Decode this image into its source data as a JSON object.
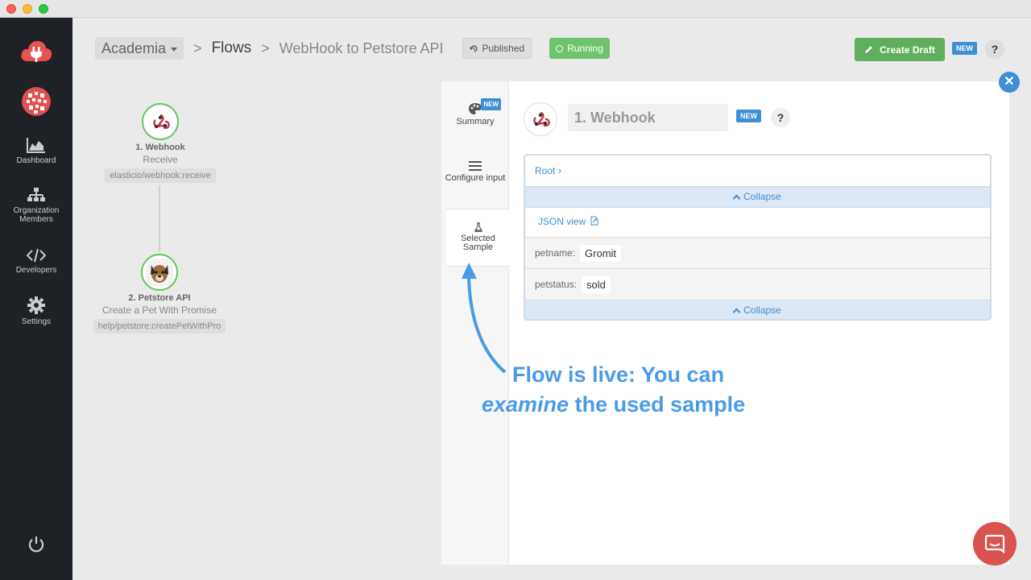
{
  "window": {
    "controls": [
      "close",
      "minimize",
      "zoom"
    ]
  },
  "sidebar": {
    "items": [
      {
        "label": "Dashboard",
        "icon": "dashboard-icon"
      },
      {
        "label": "Organization Members",
        "icon": "org-members-icon"
      },
      {
        "label": "Developers",
        "icon": "code-icon"
      },
      {
        "label": "Settings",
        "icon": "gear-icon"
      }
    ]
  },
  "header": {
    "workspace": "Academia",
    "flows": "Flows",
    "flow_name": "WebHook to Petstore API",
    "published_label": "Published",
    "running_label": "Running",
    "create_draft_label": "Create Draft",
    "new_label": "NEW",
    "help_label": "?"
  },
  "canvas": {
    "nodes": [
      {
        "title": "1. Webhook",
        "subtitle": "Receive",
        "path": "elasticio/webhook:receive"
      },
      {
        "title": "2. Petstore API",
        "subtitle": "Create a Pet With Promise",
        "path": "help/petstore:createPetWithPro"
      }
    ]
  },
  "panel": {
    "tabs": [
      {
        "label": "Summary",
        "badge": "NEW"
      },
      {
        "label": "Configure input"
      },
      {
        "label": "Selected Sample"
      }
    ],
    "step_name": "1. Webhook",
    "step_new": "NEW",
    "help_label": "?",
    "close_label": "✕",
    "sample": {
      "root_label": "Root",
      "collapse_label": "Collapse",
      "json_view_label": "JSON view",
      "fields": [
        {
          "key": "petname:",
          "value": "Gromit"
        },
        {
          "key": "petstatus:",
          "value": "sold"
        }
      ]
    }
  },
  "annotation": {
    "line1": "Flow is live: You can",
    "line2_em": "examine",
    "line2_rest": " the used sample"
  },
  "colors": {
    "accent": "#3e8fd6",
    "running": "#6fc36b",
    "draft": "#5fae5d",
    "annotation": "#4a9be6"
  }
}
